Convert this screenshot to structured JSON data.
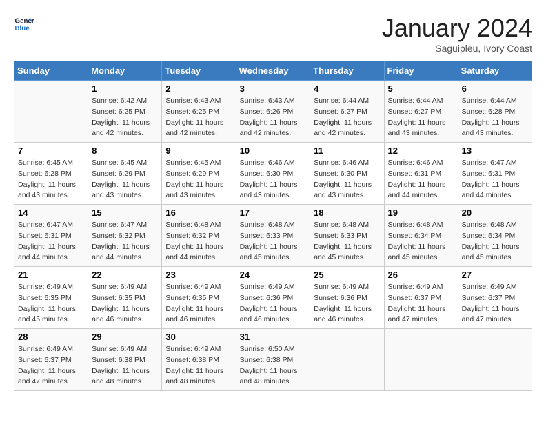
{
  "header": {
    "logo_line1": "General",
    "logo_line2": "Blue",
    "month": "January 2024",
    "location": "Saguipleu, Ivory Coast"
  },
  "days_of_week": [
    "Sunday",
    "Monday",
    "Tuesday",
    "Wednesday",
    "Thursday",
    "Friday",
    "Saturday"
  ],
  "weeks": [
    [
      {
        "num": "",
        "info": ""
      },
      {
        "num": "1",
        "info": "Sunrise: 6:42 AM\nSunset: 6:25 PM\nDaylight: 11 hours\nand 42 minutes."
      },
      {
        "num": "2",
        "info": "Sunrise: 6:43 AM\nSunset: 6:25 PM\nDaylight: 11 hours\nand 42 minutes."
      },
      {
        "num": "3",
        "info": "Sunrise: 6:43 AM\nSunset: 6:26 PM\nDaylight: 11 hours\nand 42 minutes."
      },
      {
        "num": "4",
        "info": "Sunrise: 6:44 AM\nSunset: 6:27 PM\nDaylight: 11 hours\nand 42 minutes."
      },
      {
        "num": "5",
        "info": "Sunrise: 6:44 AM\nSunset: 6:27 PM\nDaylight: 11 hours\nand 43 minutes."
      },
      {
        "num": "6",
        "info": "Sunrise: 6:44 AM\nSunset: 6:28 PM\nDaylight: 11 hours\nand 43 minutes."
      }
    ],
    [
      {
        "num": "7",
        "info": "Sunrise: 6:45 AM\nSunset: 6:28 PM\nDaylight: 11 hours\nand 43 minutes."
      },
      {
        "num": "8",
        "info": "Sunrise: 6:45 AM\nSunset: 6:29 PM\nDaylight: 11 hours\nand 43 minutes."
      },
      {
        "num": "9",
        "info": "Sunrise: 6:45 AM\nSunset: 6:29 PM\nDaylight: 11 hours\nand 43 minutes."
      },
      {
        "num": "10",
        "info": "Sunrise: 6:46 AM\nSunset: 6:30 PM\nDaylight: 11 hours\nand 43 minutes."
      },
      {
        "num": "11",
        "info": "Sunrise: 6:46 AM\nSunset: 6:30 PM\nDaylight: 11 hours\nand 43 minutes."
      },
      {
        "num": "12",
        "info": "Sunrise: 6:46 AM\nSunset: 6:31 PM\nDaylight: 11 hours\nand 44 minutes."
      },
      {
        "num": "13",
        "info": "Sunrise: 6:47 AM\nSunset: 6:31 PM\nDaylight: 11 hours\nand 44 minutes."
      }
    ],
    [
      {
        "num": "14",
        "info": "Sunrise: 6:47 AM\nSunset: 6:31 PM\nDaylight: 11 hours\nand 44 minutes."
      },
      {
        "num": "15",
        "info": "Sunrise: 6:47 AM\nSunset: 6:32 PM\nDaylight: 11 hours\nand 44 minutes."
      },
      {
        "num": "16",
        "info": "Sunrise: 6:48 AM\nSunset: 6:32 PM\nDaylight: 11 hours\nand 44 minutes."
      },
      {
        "num": "17",
        "info": "Sunrise: 6:48 AM\nSunset: 6:33 PM\nDaylight: 11 hours\nand 45 minutes."
      },
      {
        "num": "18",
        "info": "Sunrise: 6:48 AM\nSunset: 6:33 PM\nDaylight: 11 hours\nand 45 minutes."
      },
      {
        "num": "19",
        "info": "Sunrise: 6:48 AM\nSunset: 6:34 PM\nDaylight: 11 hours\nand 45 minutes."
      },
      {
        "num": "20",
        "info": "Sunrise: 6:48 AM\nSunset: 6:34 PM\nDaylight: 11 hours\nand 45 minutes."
      }
    ],
    [
      {
        "num": "21",
        "info": "Sunrise: 6:49 AM\nSunset: 6:35 PM\nDaylight: 11 hours\nand 45 minutes."
      },
      {
        "num": "22",
        "info": "Sunrise: 6:49 AM\nSunset: 6:35 PM\nDaylight: 11 hours\nand 46 minutes."
      },
      {
        "num": "23",
        "info": "Sunrise: 6:49 AM\nSunset: 6:35 PM\nDaylight: 11 hours\nand 46 minutes."
      },
      {
        "num": "24",
        "info": "Sunrise: 6:49 AM\nSunset: 6:36 PM\nDaylight: 11 hours\nand 46 minutes."
      },
      {
        "num": "25",
        "info": "Sunrise: 6:49 AM\nSunset: 6:36 PM\nDaylight: 11 hours\nand 46 minutes."
      },
      {
        "num": "26",
        "info": "Sunrise: 6:49 AM\nSunset: 6:37 PM\nDaylight: 11 hours\nand 47 minutes."
      },
      {
        "num": "27",
        "info": "Sunrise: 6:49 AM\nSunset: 6:37 PM\nDaylight: 11 hours\nand 47 minutes."
      }
    ],
    [
      {
        "num": "28",
        "info": "Sunrise: 6:49 AM\nSunset: 6:37 PM\nDaylight: 11 hours\nand 47 minutes."
      },
      {
        "num": "29",
        "info": "Sunrise: 6:49 AM\nSunset: 6:38 PM\nDaylight: 11 hours\nand 48 minutes."
      },
      {
        "num": "30",
        "info": "Sunrise: 6:49 AM\nSunset: 6:38 PM\nDaylight: 11 hours\nand 48 minutes."
      },
      {
        "num": "31",
        "info": "Sunrise: 6:50 AM\nSunset: 6:38 PM\nDaylight: 11 hours\nand 48 minutes."
      },
      {
        "num": "",
        "info": ""
      },
      {
        "num": "",
        "info": ""
      },
      {
        "num": "",
        "info": ""
      }
    ]
  ]
}
